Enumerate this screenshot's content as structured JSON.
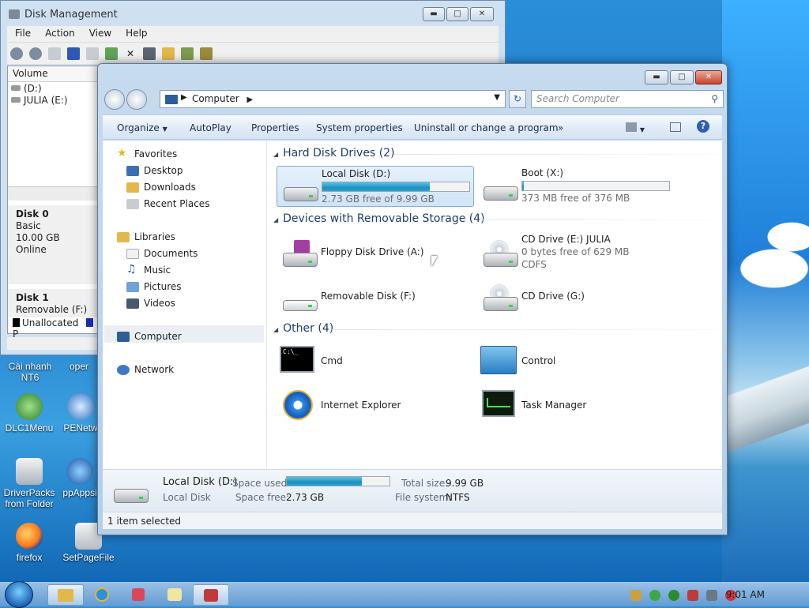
{
  "disk_mgmt": {
    "title": "Disk Management",
    "menu": [
      "File",
      "Action",
      "View",
      "Help"
    ],
    "col_volume": "Volume",
    "volumes": [
      "(D:)",
      "JULIA (E:)"
    ],
    "disk0": {
      "name": "Disk 0",
      "type": "Basic",
      "size": "10.00 GB",
      "status": "Online"
    },
    "disk1": {
      "name": "Disk 1",
      "type": "Removable (F:)"
    },
    "legend_unallocated": "Unallocated",
    "legend_partial": "P"
  },
  "explorer": {
    "address": {
      "root": "Computer"
    },
    "search_placeholder": "Search Computer",
    "commands": [
      "Organize",
      "AutoPlay",
      "Properties",
      "System properties",
      "Uninstall or change a program",
      "»"
    ],
    "nav": {
      "favorites": "Favorites",
      "desktop": "Desktop",
      "downloads": "Downloads",
      "recent": "Recent Places",
      "libraries": "Libraries",
      "documents": "Documents",
      "music": "Music",
      "pictures": "Pictures",
      "videos": "Videos",
      "computer": "Computer",
      "network": "Network"
    },
    "groups": {
      "hdd": "Hard Disk Drives (2)",
      "removable": "Devices with Removable Storage (4)",
      "other": "Other (4)"
    },
    "hdd": [
      {
        "name": "Local Disk (D:)",
        "free": "2.73 GB free of 9.99 GB",
        "used_fraction": 0.73
      },
      {
        "name": "Boot (X:)",
        "free": "373 MB free of 376 MB",
        "used_fraction": 0.01
      }
    ],
    "removable": {
      "floppy": "Floppy Disk Drive (A:)",
      "cd_e": {
        "name": "CD Drive (E:) JULIA",
        "free": "0 bytes free of 629 MB",
        "fs": "CDFS"
      },
      "removable_f": "Removable Disk (F:)",
      "cd_g": "CD Drive (G:)"
    },
    "other": {
      "cmd": "Cmd",
      "control": "Control",
      "ie": "Internet Explorer",
      "taskmgr": "Task Manager"
    },
    "details": {
      "name": "Local Disk (D:)",
      "type": "Local Disk",
      "space_used_label": "Space used:",
      "space_free_label": "Space free:",
      "space_free": "2.73 GB",
      "total_label": "Total size:",
      "total": "9.99 GB",
      "fs_label": "File system:",
      "fs": "NTFS",
      "used_fraction": 0.73
    },
    "status": "1 item selected"
  },
  "desktop_icons": {
    "cai_nhanh": "Cài nhanh NT6",
    "oper": "oper",
    "dlc1menu": "DLC1Menu",
    "penetw": "PENetw",
    "driverpacks": "DriverPacks from Folder",
    "ppapps": "ppAppsi",
    "firefox": "firefox",
    "setpagefile": "SetPageFile"
  },
  "taskbar": {
    "clock": "9:01 AM"
  },
  "colors": {
    "accent": "#1e8fc0",
    "selection": "#cfe4f7"
  }
}
